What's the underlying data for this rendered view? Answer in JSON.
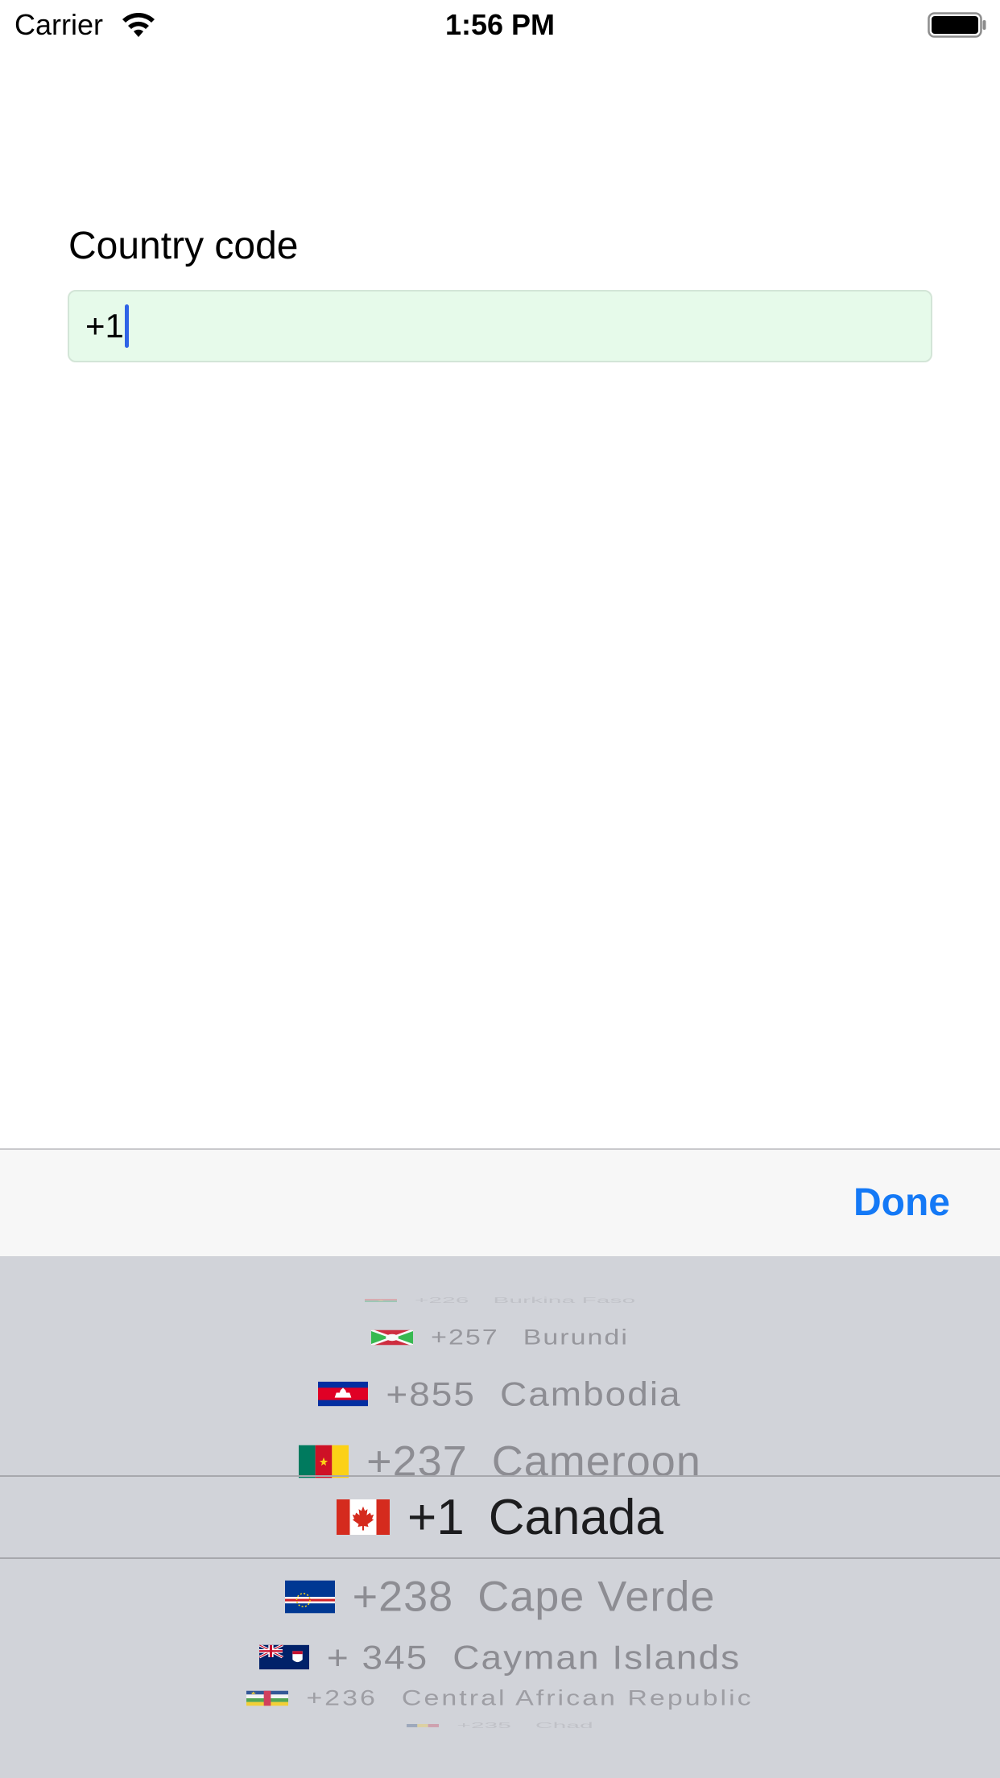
{
  "status_bar": {
    "carrier": "Carrier",
    "time": "1:56 PM"
  },
  "form": {
    "label": "Country code",
    "value": "+1",
    "colors": {
      "field_background": "#e6faea",
      "caret": "#2f63e6"
    }
  },
  "toolbar": {
    "done_label": "Done",
    "colors": {
      "accent": "#1479f6"
    }
  },
  "picker": {
    "selected_index": 4,
    "rows": [
      {
        "flag": "burkina-faso-flag",
        "code": "+226",
        "country": "Burkina Faso"
      },
      {
        "flag": "burundi-flag",
        "code": "+257",
        "country": "Burundi"
      },
      {
        "flag": "cambodia-flag",
        "code": "+855",
        "country": "Cambodia"
      },
      {
        "flag": "cameroon-flag",
        "code": "+237",
        "country": "Cameroon"
      },
      {
        "flag": "canada-flag",
        "code": "+1",
        "country": "Canada"
      },
      {
        "flag": "cape-verde-flag",
        "code": "+238",
        "country": "Cape Verde"
      },
      {
        "flag": "cayman-islands-flag",
        "code": "+ 345",
        "country": "Cayman Islands"
      },
      {
        "flag": "central-african-republic-flag",
        "code": "+236",
        "country": "Central African Republic"
      },
      {
        "flag": "chad-flag",
        "code": "+235",
        "country": "Chad"
      }
    ]
  }
}
